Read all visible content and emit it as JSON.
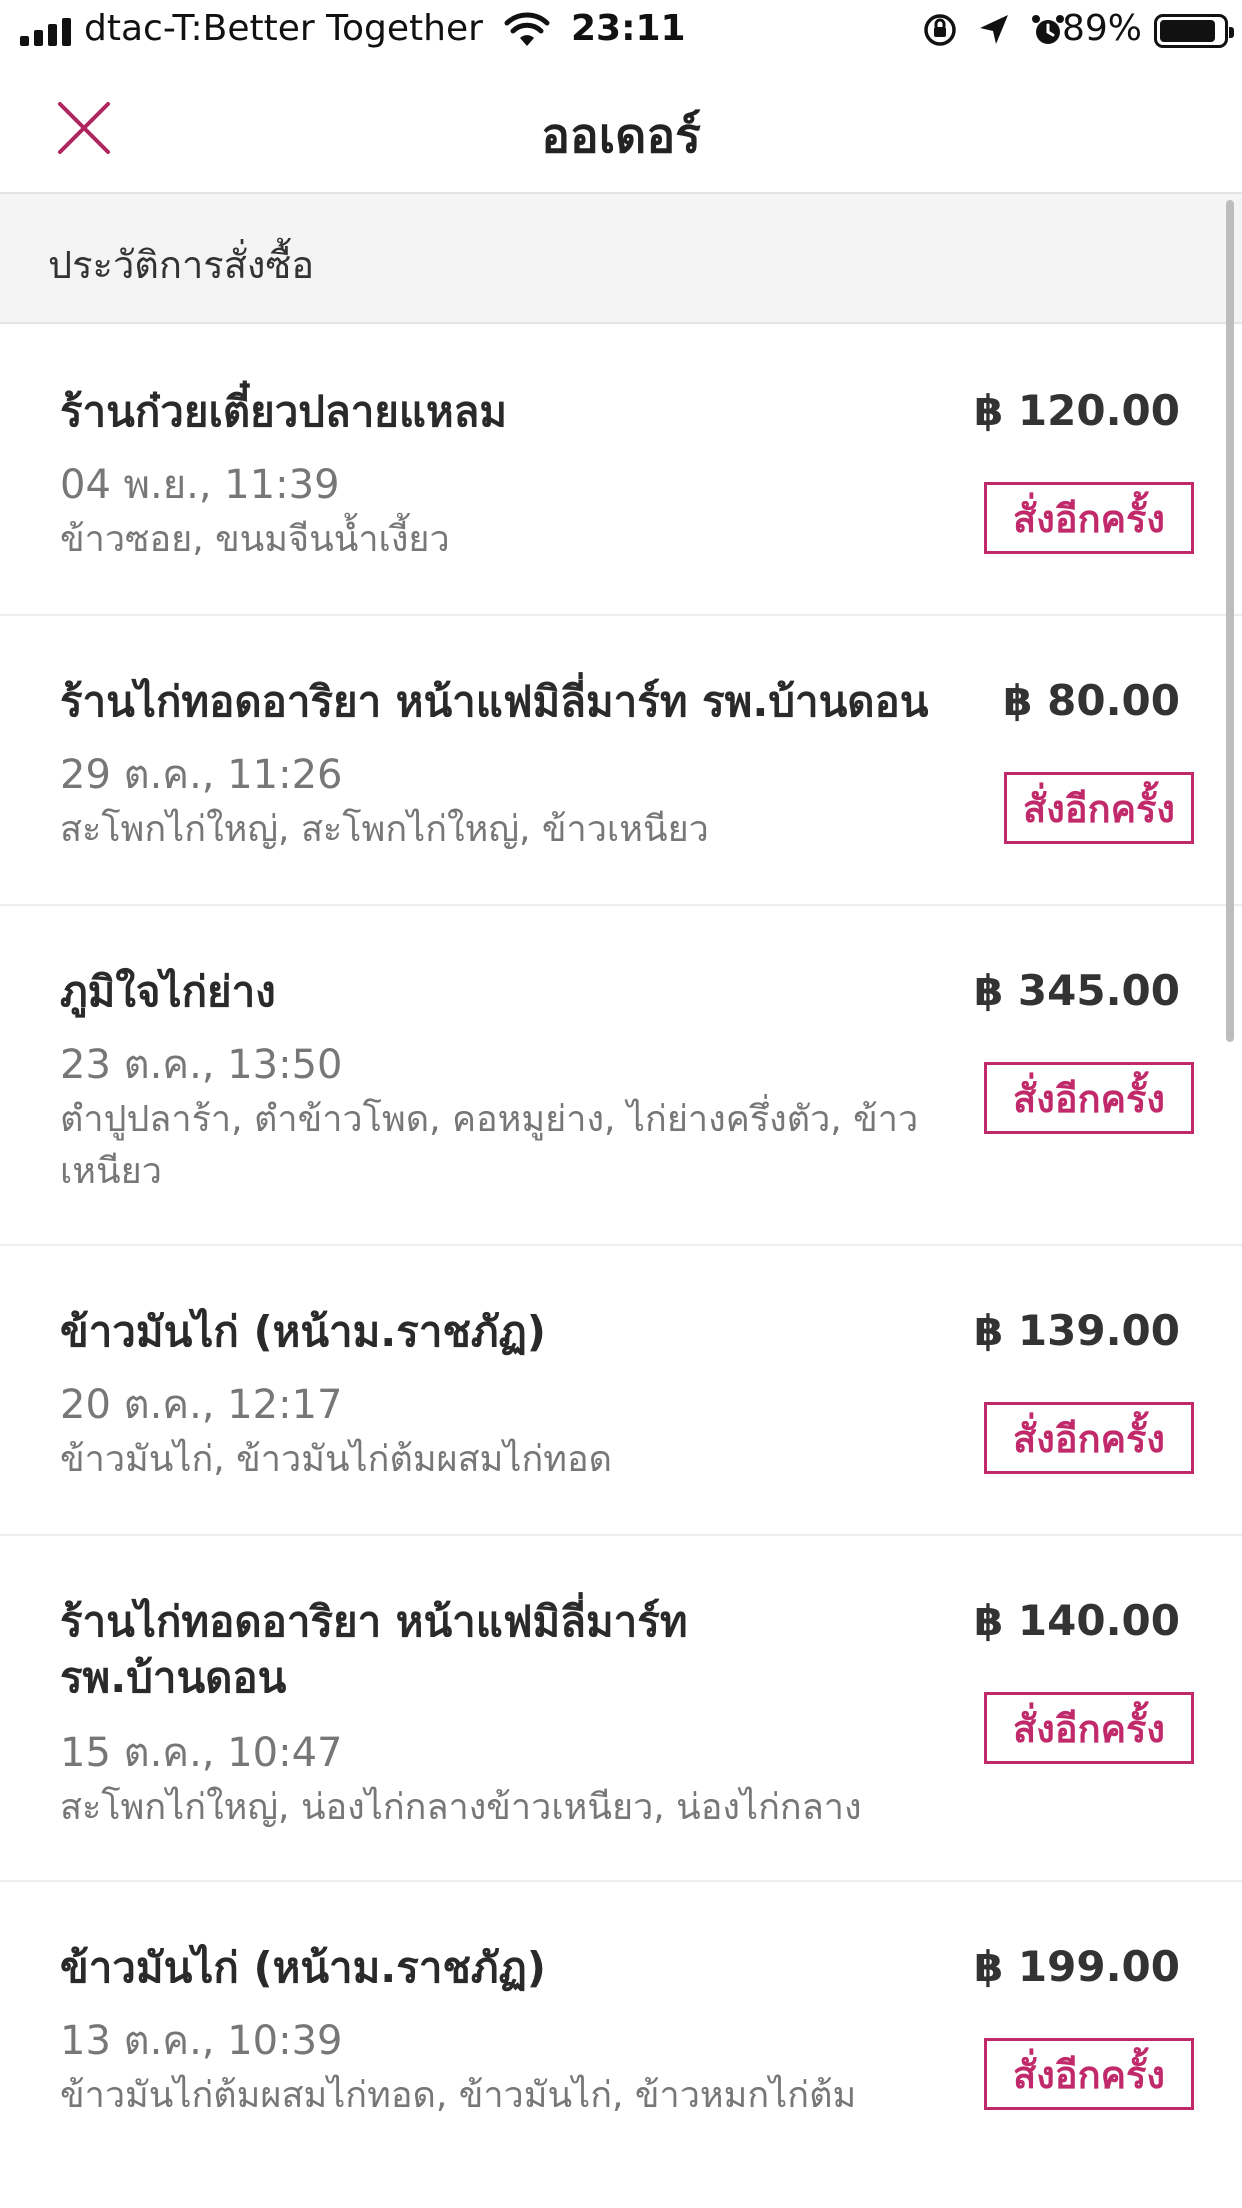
{
  "status_bar": {
    "carrier": "dtac-T:Better Together",
    "time": "23:11",
    "battery_percent": "89%",
    "battery_level": 0.89,
    "icons": [
      "signal-icon",
      "wifi-icon",
      "orientation-lock-icon",
      "location-icon",
      "alarm-icon",
      "battery-icon"
    ]
  },
  "nav": {
    "title": "ออเดอร์",
    "close_icon": "close-icon"
  },
  "section": {
    "title": "ประวัติการสั่งซื้อ"
  },
  "colors": {
    "accent": "#c02a6a",
    "section_bg": "#f4f4f4",
    "muted_text": "#777777"
  },
  "reorder_label": "สั่งอีกครั้ง",
  "orders": [
    {
      "name": "ร้านก๋วยเตี๋ยวปลายแหลม",
      "date": "04 พ.ย., 11:39",
      "items": "ข้าวซอย, ขนมจีนน้ำเงี้ยว",
      "price": "฿ 120.00"
    },
    {
      "name": "ร้านไก่ทอดอาริยา หน้าแฟมิลี่มาร์ท รพ.บ้านดอน",
      "date": "29 ต.ค., 11:26",
      "items": "สะโพกไก่ใหญ่, สะโพกไก่ใหญ่, ข้าวเหนียว",
      "price": "฿ 80.00"
    },
    {
      "name": "ภูมิใจไก่ย่าง",
      "date": "23 ต.ค., 13:50",
      "items": "ตำปูปลาร้า, ตำข้าวโพด, คอหมูย่าง, ไก่ย่างครึ่งตัว, ข้าวเหนียว",
      "price": "฿ 345.00"
    },
    {
      "name": "ข้าวมันไก่ (หน้าม.ราชภัฏ)",
      "date": "20 ต.ค., 12:17",
      "items": "ข้าวมันไก่, ข้าวมันไก่ต้มผสมไก่ทอด",
      "price": "฿ 139.00"
    },
    {
      "name": "ร้านไก่ทอดอาริยา หน้าแฟมิลี่มาร์ท รพ.บ้านดอน",
      "date": "15 ต.ค., 10:47",
      "items": "สะโพกไก่ใหญ่, น่องไก่กลางข้าวเหนียว, น่องไก่กลาง",
      "price": "฿ 140.00"
    },
    {
      "name": "ข้าวมันไก่ (หน้าม.ราชภัฏ)",
      "date": "13 ต.ค., 10:39",
      "items": "ข้าวมันไก่ต้มผสมไก่ทอด, ข้าวมันไก่, ข้าวหมกไก่ต้ม",
      "price": "฿ 199.00"
    }
  ]
}
